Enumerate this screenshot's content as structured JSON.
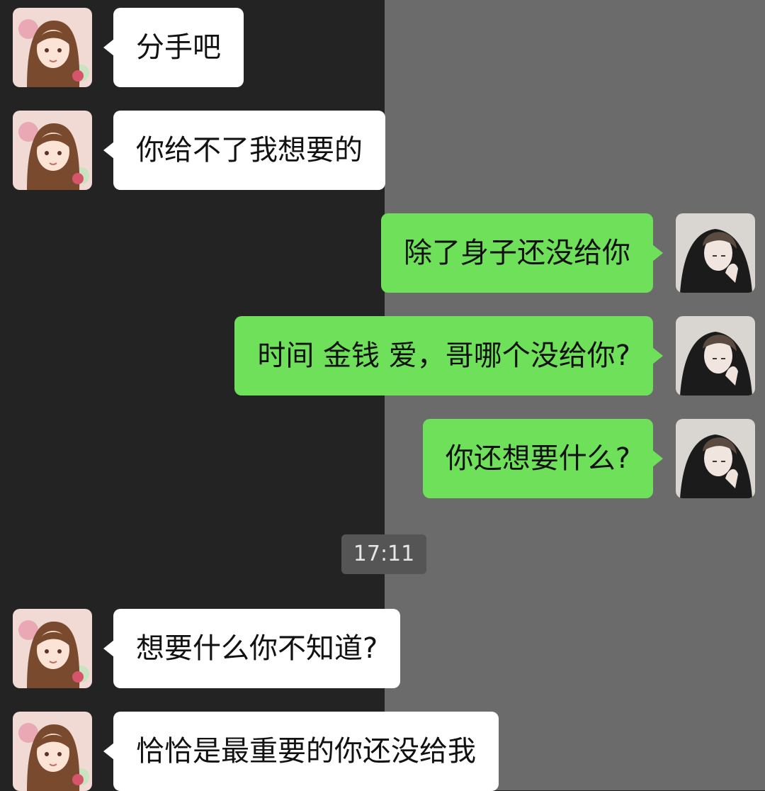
{
  "conversation": {
    "messages": [
      {
        "sender": "her",
        "text": "分手吧"
      },
      {
        "sender": "her",
        "text": "你给不了我想要的"
      },
      {
        "sender": "me",
        "text": "除了身子还没给你"
      },
      {
        "sender": "me",
        "text": "时间 金钱 爱，哥哪个没给你?"
      },
      {
        "sender": "me",
        "text": "你还想要什么?"
      },
      {
        "sender": "her",
        "text": "想要什么你不知道?"
      },
      {
        "sender": "her",
        "text": "恰恰是最重要的你还没给我"
      }
    ],
    "timestamp": "17:11"
  },
  "avatars": {
    "her": "girl-avatar-icon",
    "me": "boy-avatar-icon"
  },
  "colors": {
    "incoming_bubble": "#ffffff",
    "outgoing_bubble": "#6fe05a",
    "background_left": "#232323",
    "background_right": "#6b6b6b",
    "timestamp_bg": "#555555"
  }
}
